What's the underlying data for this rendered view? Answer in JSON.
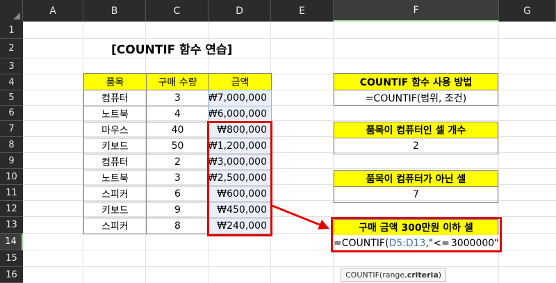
{
  "columns": [
    "A",
    "B",
    "C",
    "D",
    "E",
    "F",
    "G"
  ],
  "rows": [
    "1",
    "2",
    "3",
    "4",
    "5",
    "6",
    "7",
    "8",
    "9",
    "10",
    "11",
    "12",
    "13",
    "14",
    "15",
    "16"
  ],
  "title": "[COUNTIF 함수 연습]",
  "table": {
    "headers": [
      "품목",
      "구매 수량",
      "금액"
    ],
    "rows": [
      [
        "컴퓨터",
        "3",
        "₩7,000,000"
      ],
      [
        "노트북",
        "4",
        "₩6,000,000"
      ],
      [
        "마우스",
        "40",
        "₩800,000"
      ],
      [
        "키보드",
        "50",
        "₩1,200,000"
      ],
      [
        "컴퓨터",
        "2",
        "₩3,000,000"
      ],
      [
        "노트북",
        "3",
        "₩2,500,000"
      ],
      [
        "스피커",
        "6",
        "₩600,000"
      ],
      [
        "키보드",
        "9",
        "₩450,000"
      ],
      [
        "스피커",
        "8",
        "₩240,000"
      ]
    ]
  },
  "panel": {
    "usage_title": "COUNTIF 함수 사용 방법",
    "usage_syntax": "=COUNTIF(범위, 조건)",
    "q1_title": "품목이 컴퓨터인 셀 개수",
    "q1_value": "2",
    "q2_title": "품목이 컴퓨터가 아닌 셀",
    "q2_value": "7",
    "q3_title": "구매 금액 300만원 이하 셀",
    "q3_formula_prefix": "=COUNTIF(",
    "q3_formula_ref": "D5:D13",
    "q3_formula_mid": ",\"<=",
    "q3_formula_suffix": "3000000\")"
  },
  "tooltip": {
    "fn": "COUNTIF(range, ",
    "arg": "criteria",
    "close": ")"
  },
  "colors": {
    "highlight_yellow": "#ffff00",
    "annotation_red": "#e00000",
    "range_blue": "#4472c4"
  }
}
